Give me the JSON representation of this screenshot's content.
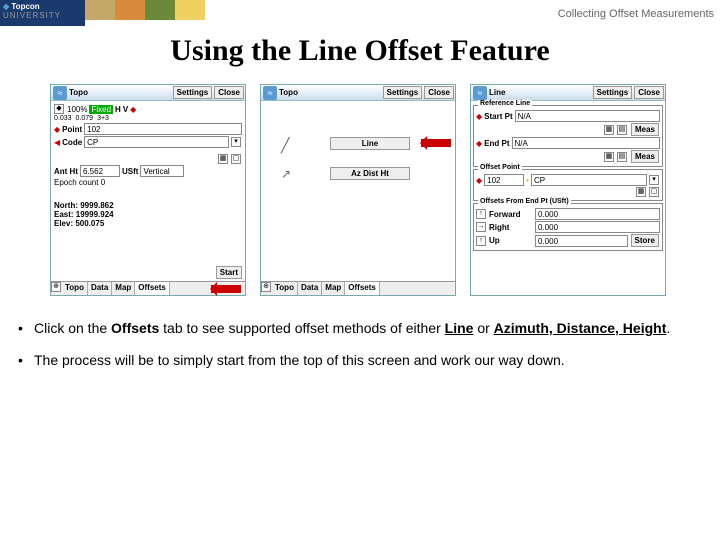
{
  "breadcrumb": "Collecting Offset Measurements",
  "title": "Using the Line Offset Feature",
  "logo": {
    "brand": "Topcon",
    "sub": "UNIVERSITY"
  },
  "s1": {
    "title": "Topo",
    "settings": "Settings",
    "close": "Close",
    "bar": {
      "pct": "100%",
      "fixed": "Fixed",
      "h": "H",
      "v": "V",
      "hval": "0.033",
      "vval": "0.079",
      "s": "3+3"
    },
    "point_lbl": "Point",
    "point": "102",
    "code_lbl": "Code",
    "code": "CP",
    "antht_lbl": "Ant Ht",
    "antht": "6.562",
    "unit": "USft",
    "vert": "Vertical",
    "epoch": "Epoch count 0",
    "north": "North: 9999.862",
    "east": "East: 19999.924",
    "elev": "Elev: 500.075",
    "start": "Start",
    "tabs": [
      "Topo",
      "Data",
      "Map",
      "Offsets"
    ]
  },
  "s2": {
    "title": "Topo",
    "settings": "Settings",
    "close": "Close",
    "opt1": "Line",
    "opt2": "Az Dist Ht",
    "tabs": [
      "Topo",
      "Data",
      "Map",
      "Offsets"
    ]
  },
  "s3": {
    "title": "Line",
    "settings": "Settings",
    "close": "Close",
    "ref": "Reference Line",
    "startpt": "Start Pt",
    "startv": "N/A",
    "meas": "Meas",
    "endpt": "End Pt",
    "endv": "N/A",
    "off_title": "Offset Point",
    "off_pt": "102",
    "off_code": "CP",
    "offsets_title": "Offsets From End Pt (USft)",
    "fwd": "Forward",
    "fwdv": "0.000",
    "right": "Right",
    "rightv": "0.000",
    "up": "Up",
    "upv": "0.000",
    "store": "Store"
  },
  "bullets": [
    {
      "pre": "Click on the ",
      "b1": "Offsets",
      "mid": " tab to see supported offset methods of either ",
      "u1": "Line",
      "or": " or ",
      "u2": "Azimuth, Distance, Height",
      "post": "."
    },
    {
      "text": "The process will be to simply start from the top of this screen and work our way down."
    }
  ]
}
